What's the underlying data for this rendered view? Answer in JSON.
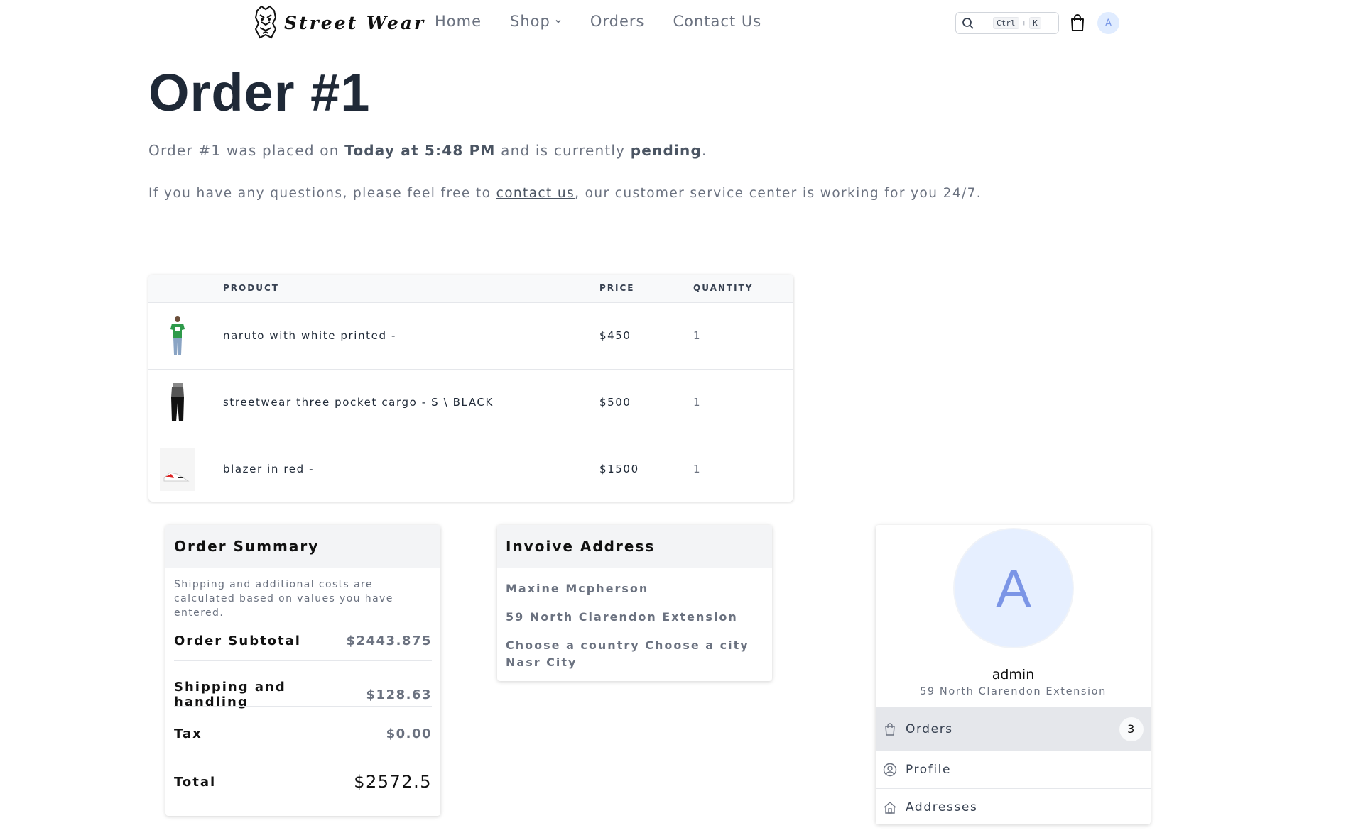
{
  "brand": {
    "name": "Street Wear"
  },
  "nav": {
    "items": [
      "Home",
      "Shop",
      "Orders",
      "Contact Us"
    ]
  },
  "search": {
    "kbd_ctrl": "Ctrl",
    "kbd_plus": "+",
    "kbd_k": "K"
  },
  "user": {
    "initial": "A"
  },
  "order": {
    "title": "Order #1",
    "placed_prefix": "Order #1 was placed on ",
    "placed_when": "Today at 5:48 PM",
    "placed_mid": " and is currently ",
    "status": "pending",
    "placed_end": ".",
    "help_prefix": "If you have any questions, please feel free to ",
    "help_link": "contact us",
    "help_suffix": ", our customer service center is working for you 24/7."
  },
  "table": {
    "headers": {
      "product": "PRODUCT",
      "price": "PRICE",
      "quantity": "QUANTITY"
    },
    "rows": [
      {
        "name": "naruto with white printed -",
        "price": "$450",
        "qty": "1"
      },
      {
        "name": "streetwear three pocket cargo - S \\ BLACK",
        "price": "$500",
        "qty": "1"
      },
      {
        "name": "blazer in red -",
        "price": "$1500",
        "qty": "1"
      }
    ]
  },
  "summary": {
    "title": "Order Summary",
    "note": "Shipping and additional costs are calculated based on values you have entered.",
    "subtotal_label": "Order Subtotal",
    "subtotal_value": "$2443.875",
    "shipping_label": "Shipping and handling",
    "shipping_value": "$128.63",
    "tax_label": "Tax",
    "tax_value": "$0.00",
    "total_label": "Total",
    "total_value": "$2572.5"
  },
  "invoice": {
    "title": "Invoive Address",
    "name": "Maxine Mcpherson",
    "street": "59 North Clarendon Extension",
    "city": "Choose a country Choose a city Nasr City"
  },
  "profile": {
    "initial": "A",
    "name": "admin",
    "address": "59 North Clarendon Extension",
    "menu": {
      "orders": "Orders",
      "orders_count": "3",
      "profile": "Profile",
      "addresses": "Addresses"
    }
  }
}
